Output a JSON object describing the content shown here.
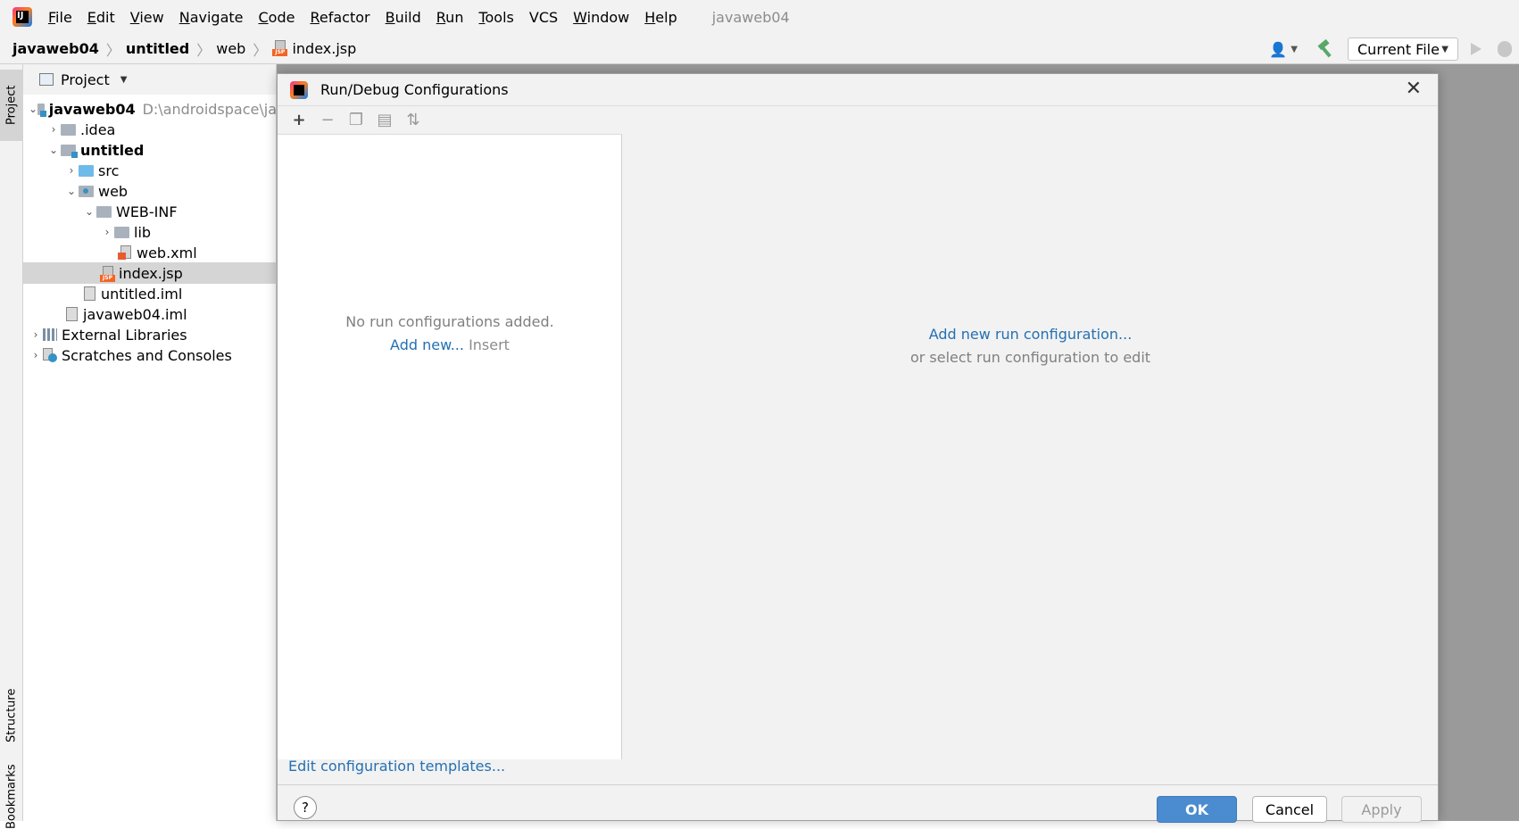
{
  "menu": {
    "items": [
      {
        "u": "F",
        "rest": "ile"
      },
      {
        "u": "E",
        "rest": "dit"
      },
      {
        "u": "V",
        "rest": "iew"
      },
      {
        "u": "N",
        "rest": "avigate"
      },
      {
        "u": "C",
        "rest": "ode"
      },
      {
        "u": "R",
        "rest": "efactor"
      },
      {
        "u": "B",
        "rest": "uild"
      },
      {
        "u": "R",
        "rest": "un"
      },
      {
        "u": "T",
        "rest": "ools"
      },
      {
        "u": "",
        "rest": "VCS"
      },
      {
        "u": "W",
        "rest": "indow"
      },
      {
        "u": "H",
        "rest": "elp"
      }
    ],
    "window_title": "javaweb04"
  },
  "breadcrumb": {
    "project": "javaweb04",
    "module": "untitled",
    "folder": "web",
    "file": "index.jsp"
  },
  "toolbar": {
    "run_config": "Current File"
  },
  "stripe": {
    "project": "Project",
    "structure": "Structure",
    "bookmarks": "Bookmarks"
  },
  "project_panel": {
    "title": "Project",
    "tree": {
      "root": {
        "label": "javaweb04",
        "path": "D:\\androidspace\\ja"
      },
      "idea": ".idea",
      "untitled": "untitled",
      "src": "src",
      "web": "web",
      "webinf": "WEB-INF",
      "lib": "lib",
      "webxml": "web.xml",
      "indexjsp": "index.jsp",
      "untitled_iml": "untitled.iml",
      "javaweb_iml": "javaweb04.iml",
      "external": "External Libraries",
      "scratches": "Scratches and Consoles"
    }
  },
  "dialog": {
    "title": "Run/Debug Configurations",
    "empty_message": "No run configurations added.",
    "add_new": "Add new...",
    "insert_hint": "Insert",
    "templates_link": "Edit configuration templates...",
    "right_link": "Add new run configuration...",
    "right_sub": "or select run configuration to edit",
    "ok": "OK",
    "cancel": "Cancel",
    "apply": "Apply",
    "help": "?"
  },
  "icons": {
    "add": "+",
    "remove": "−",
    "copy": "❐",
    "folder": "▤",
    "sort": "⇅",
    "close": "✕"
  }
}
